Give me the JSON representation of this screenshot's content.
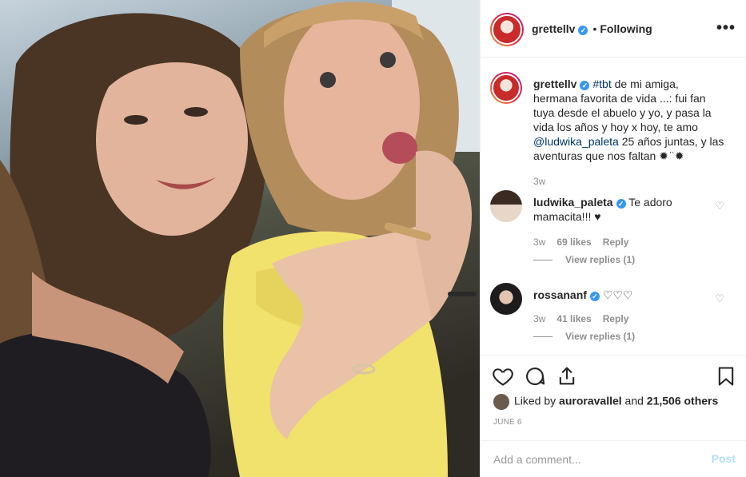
{
  "post": {
    "author": "grettellv",
    "follow_separator": "•",
    "follow_status": "Following",
    "more_label": "•••"
  },
  "caption": {
    "user": "grettellv",
    "hashtag": "#tbt",
    "text_1": " de mi amiga, hermana favorita de vida ...: fui fan tuya desde el abuelo y yo, y pasa la vida los años y hoy x hoy, te amo ",
    "mention": "@ludwika_paleta",
    "text_2": " 25 años juntas, y las aventuras que nos faltan ✹ ̈ ✹",
    "time": "3w"
  },
  "comments": [
    {
      "user": "ludwika_paleta",
      "text": "Te adoro mamacita!!! ♥",
      "time": "3w",
      "likes": "69 likes",
      "reply": "Reply",
      "view_replies": "View replies (1)"
    },
    {
      "user": "rossananf",
      "text": "♡♡♡",
      "time": "3w",
      "likes": "41 likes",
      "reply": "Reply",
      "view_replies": "View replies (1)"
    }
  ],
  "likes": {
    "prefix": "Liked by ",
    "user": "auroravallel",
    "mid": " and ",
    "count": "21,506 others"
  },
  "date": "JUNE 6",
  "add_comment": {
    "placeholder": "Add a comment...",
    "post_label": "Post"
  },
  "colors": {
    "accent": "#3897f0",
    "post_disabled": "#b2dffc",
    "meta_gray": "#8e8e8e"
  },
  "icons": [
    "heart-icon",
    "comment-icon",
    "share-icon",
    "bookmark-icon",
    "verified-icon",
    "more-icon"
  ]
}
